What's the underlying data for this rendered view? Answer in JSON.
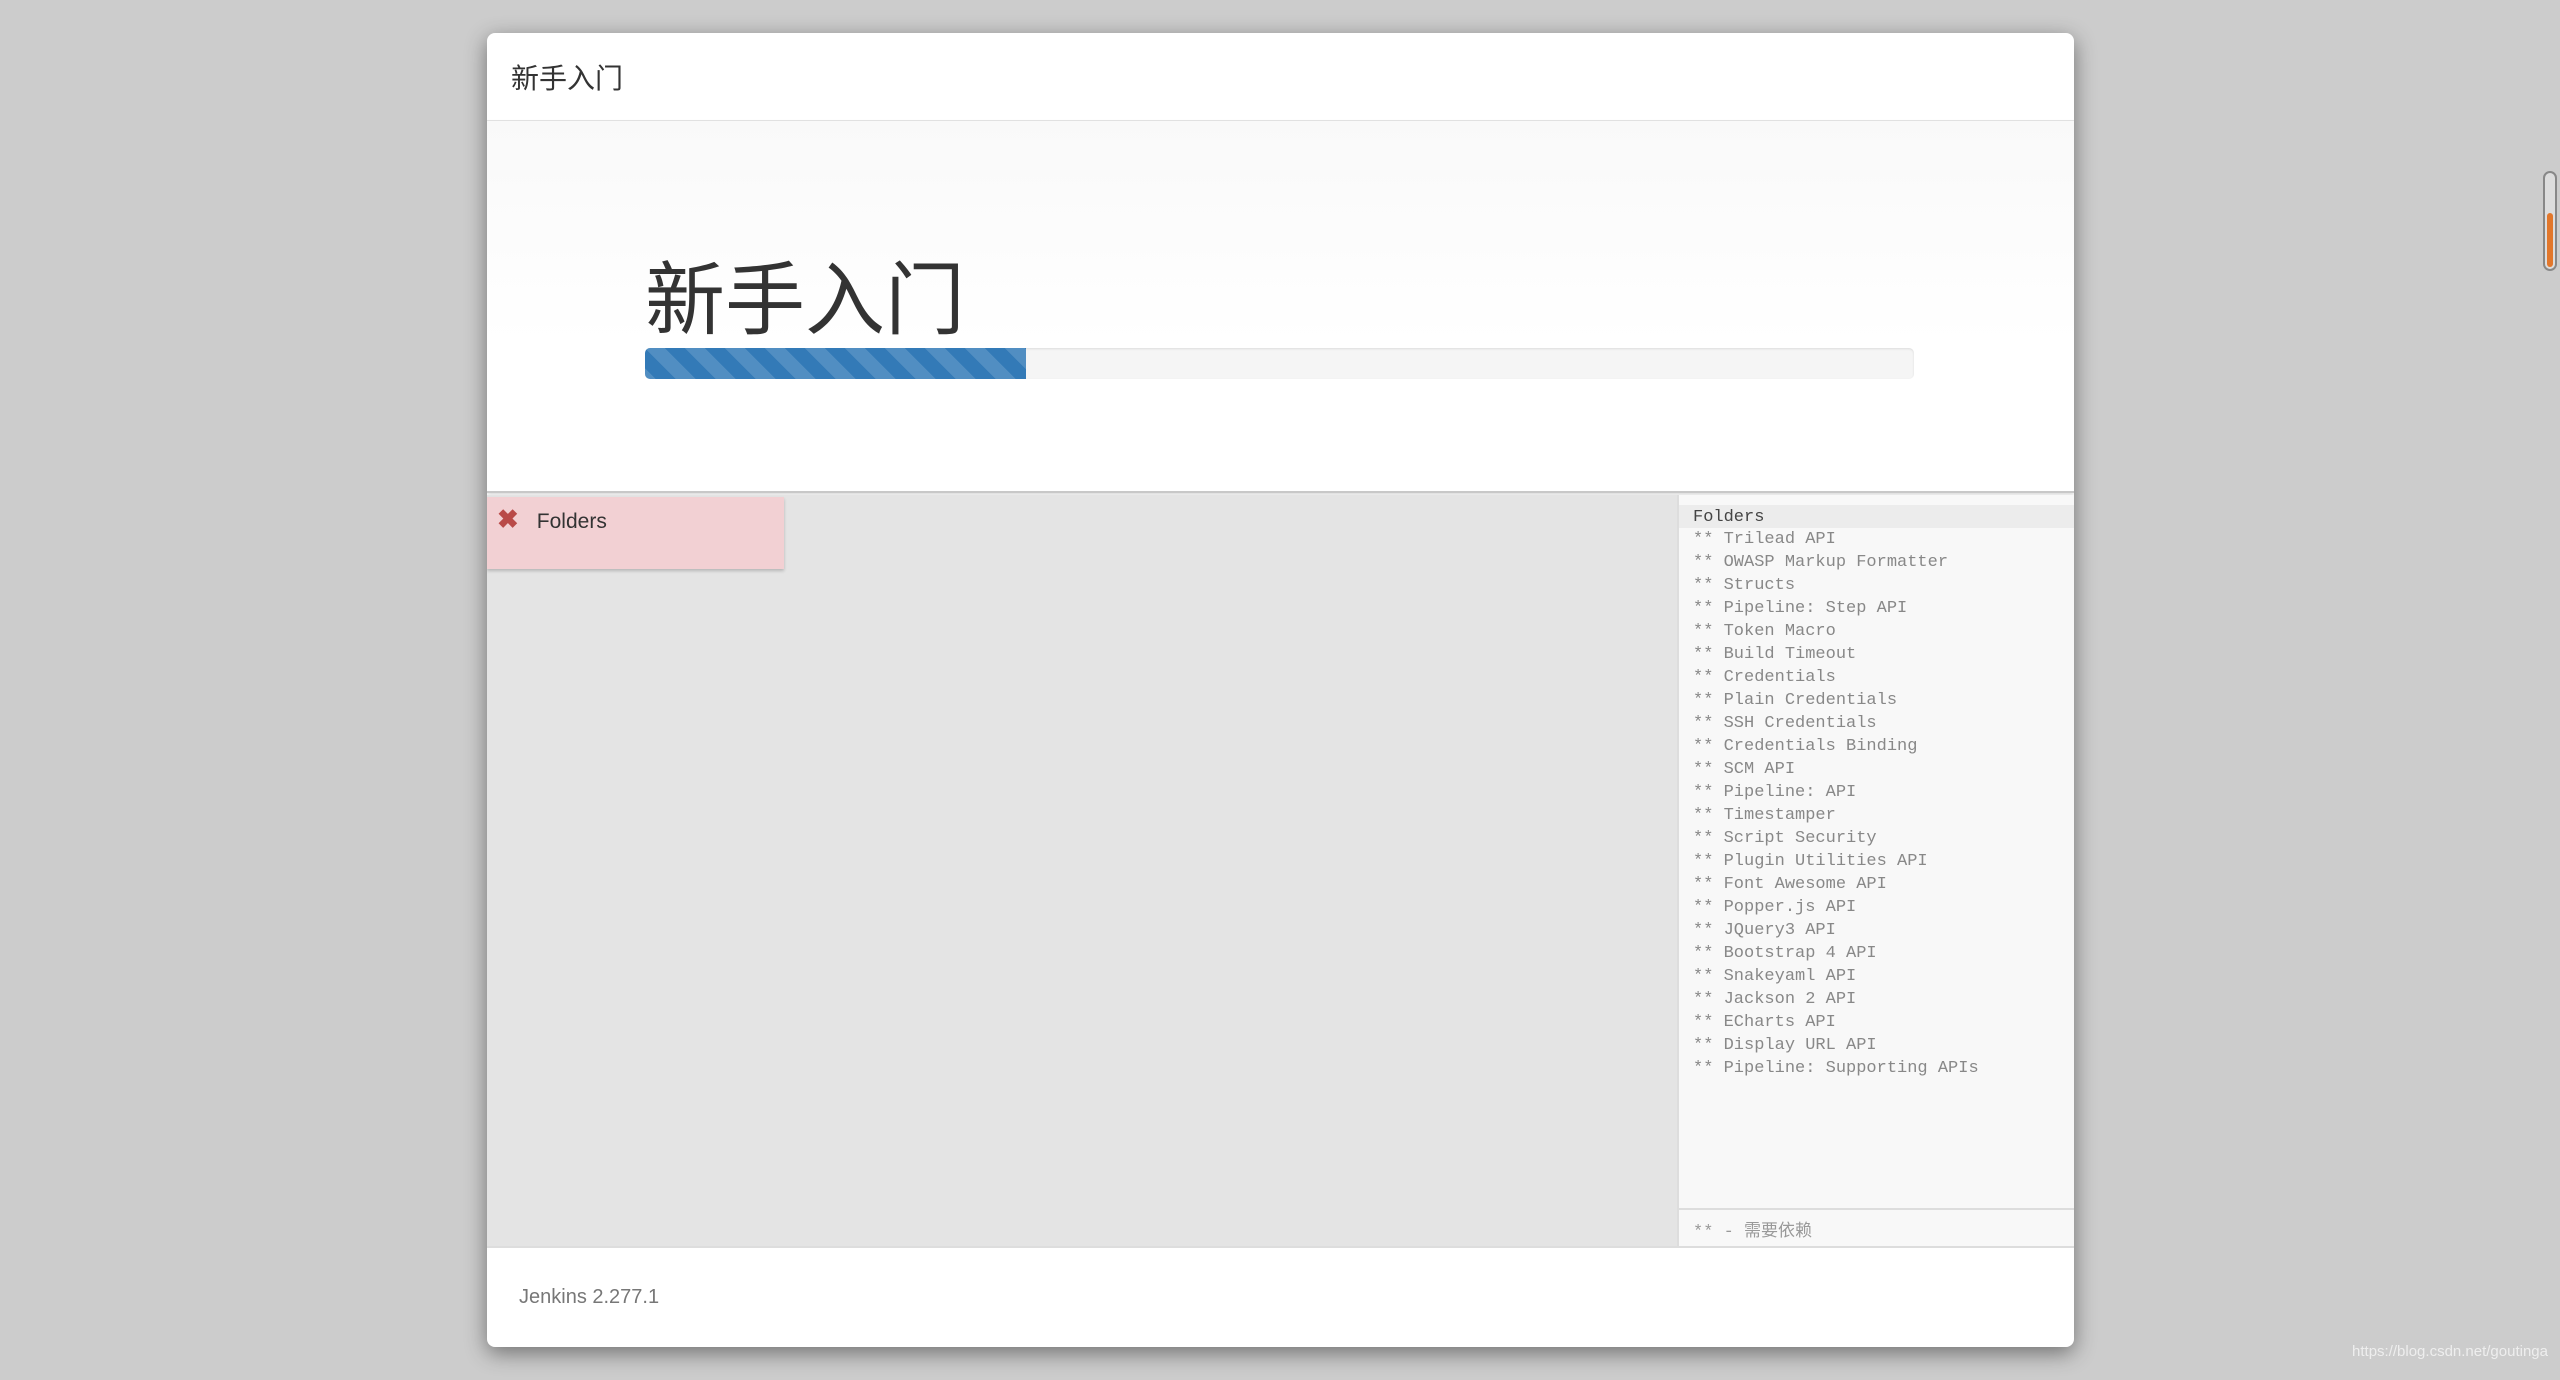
{
  "header": {
    "title": "新手入门"
  },
  "hero": {
    "title": "新手入门",
    "progress_percent": 30,
    "progress_color": "#337ab7"
  },
  "plugins": [
    {
      "name": "Folders",
      "status": "failed",
      "status_icon": "close-icon",
      "status_color": "#b94a48"
    }
  ],
  "log": {
    "header": "Folders",
    "items": [
      "** Trilead API",
      "** OWASP Markup Formatter",
      "** Structs",
      "** Pipeline: Step API",
      "** Token Macro",
      "** Build Timeout",
      "** Credentials",
      "** Plain Credentials",
      "** SSH Credentials",
      "** Credentials Binding",
      "** SCM API",
      "** Pipeline: API",
      "** Timestamper",
      "** Script Security",
      "** Plugin Utilities API",
      "** Font Awesome API",
      "** Popper.js API",
      "** JQuery3 API",
      "** Bootstrap 4 API",
      "** Snakeyaml API",
      "** Jackson 2 API",
      "** ECharts API",
      "** Display URL API",
      "** Pipeline: Supporting APIs"
    ],
    "legend": "** - 需要依赖"
  },
  "footer": {
    "version": "Jenkins 2.277.1"
  },
  "watermark": "https://blog.csdn.net/goutinga"
}
